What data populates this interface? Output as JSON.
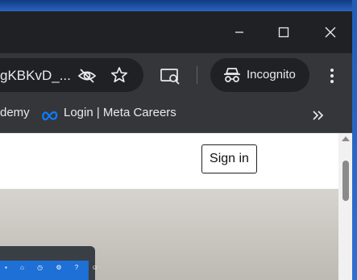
{
  "window_controls": {
    "minimize": "minimize-icon",
    "maximize": "maximize-icon",
    "close": "close-icon"
  },
  "toolbar": {
    "url_fragment": "gKBKvD_...",
    "incognito_label": "Incognito"
  },
  "bookmarks": {
    "items": [
      {
        "label": "demy"
      },
      {
        "label": "Login | Meta Careers"
      }
    ]
  },
  "page": {
    "sign_in_label": "Sign in"
  },
  "colors": {
    "meta_blue": "#0a7cff",
    "window_bg": "#202124",
    "toolbar_bg": "#35363a"
  }
}
